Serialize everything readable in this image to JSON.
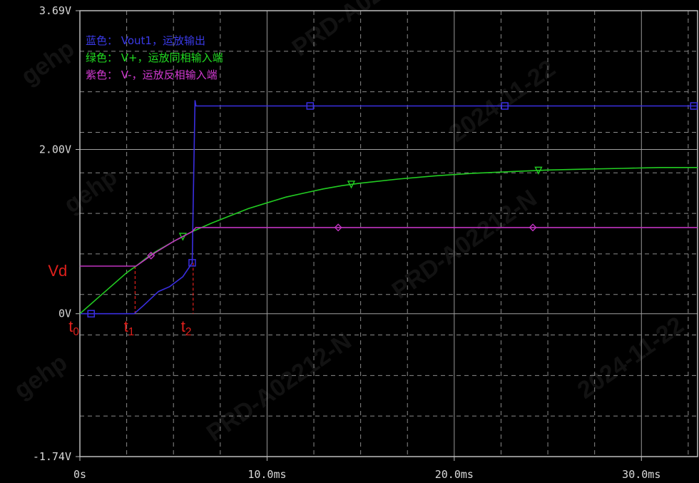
{
  "chart_data": {
    "type": "line",
    "xlabel": "",
    "ylabel": "",
    "xlim": [
      0,
      33.0
    ],
    "ylim": [
      -1.74,
      3.69
    ],
    "grid": true,
    "x_tick_labels": [
      {
        "value": 0,
        "label": "0s"
      },
      {
        "value": 10,
        "label": "10.0ms"
      },
      {
        "value": 20,
        "label": "20.0ms"
      },
      {
        "value": 30,
        "label": "30.0ms"
      }
    ],
    "y_tick_labels": [
      {
        "value": 3.69,
        "label": "3.69V"
      },
      {
        "value": 2.0,
        "label": "2.00V"
      },
      {
        "value": 0,
        "label": "0V"
      },
      {
        "value": -1.74,
        "label": "-1.74V"
      }
    ],
    "legend_lines": [
      {
        "text": "蓝色： Vout1，运放输出",
        "color": "#3a3ae8"
      },
      {
        "text": "绿色： V+，运放同相输入端",
        "color": "#22dd22"
      },
      {
        "text": "紫色： V-，运放反相输入端",
        "color": "#d23ad2"
      }
    ],
    "legend_position": "top-left",
    "series": [
      {
        "color": "#3a2ee0",
        "marker": "square",
        "x": [
          0,
          1.2,
          2.9,
          3.4,
          4.2,
          4.8,
          5.5,
          6.0,
          6.05,
          6.15,
          6.2,
          12.3,
          22.7,
          33.0
        ],
        "y": [
          0,
          0,
          0,
          0.1,
          0.27,
          0.33,
          0.45,
          0.62,
          1.3,
          2.6,
          2.53,
          2.53,
          2.53,
          2.53
        ],
        "marker_x": [
          0.6,
          6.0,
          12.3,
          22.7,
          32.8
        ]
      },
      {
        "color": "#22cc22",
        "marker": "triangle-down",
        "x": [
          0,
          0.5,
          1,
          1.5,
          2,
          2.5,
          3,
          3.5,
          4,
          5,
          6,
          7,
          8,
          9,
          10,
          11,
          12,
          13,
          14,
          15,
          17,
          19,
          21,
          23,
          25,
          27,
          29,
          31,
          33
        ],
        "y": [
          0,
          0.1,
          0.2,
          0.3,
          0.4,
          0.5,
          0.58,
          0.67,
          0.75,
          0.88,
          1.0,
          1.1,
          1.19,
          1.28,
          1.35,
          1.42,
          1.47,
          1.52,
          1.56,
          1.59,
          1.64,
          1.68,
          1.71,
          1.73,
          1.75,
          1.76,
          1.77,
          1.78,
          1.78
        ],
        "marker_x": [
          5.5,
          14.5,
          24.5
        ]
      },
      {
        "color": "#c033c0",
        "marker": "diamond",
        "x": [
          0,
          2.9,
          3.0,
          3.5,
          4.0,
          5.0,
          6.0,
          6.2,
          14,
          24.5,
          33.0
        ],
        "y": [
          0.58,
          0.58,
          0.58,
          0.66,
          0.74,
          0.88,
          1.0,
          1.05,
          1.05,
          1.05,
          1.05
        ],
        "marker_x": [
          3.8,
          13.8,
          24.2
        ]
      }
    ],
    "annotations": [
      {
        "text": "Vd",
        "x": -1.7,
        "y": 0.58,
        "size": 22
      },
      {
        "text": "t",
        "sub": "0",
        "x": -0.6,
        "y": -0.1,
        "size": 22
      },
      {
        "text": "t",
        "sub": "1",
        "x": 2.35,
        "y": -0.1,
        "size": 22
      },
      {
        "text": "t",
        "sub": "2",
        "x": 5.4,
        "y": -0.1,
        "size": 22
      }
    ],
    "guide_lines": [
      {
        "x": 2.95,
        "y_top": 0.58
      },
      {
        "x": 6.05,
        "y_top": 0.62
      }
    ]
  },
  "watermark": {
    "lines": [
      "gehp",
      "PRD-A02212-N",
      "2024-11-22"
    ]
  }
}
